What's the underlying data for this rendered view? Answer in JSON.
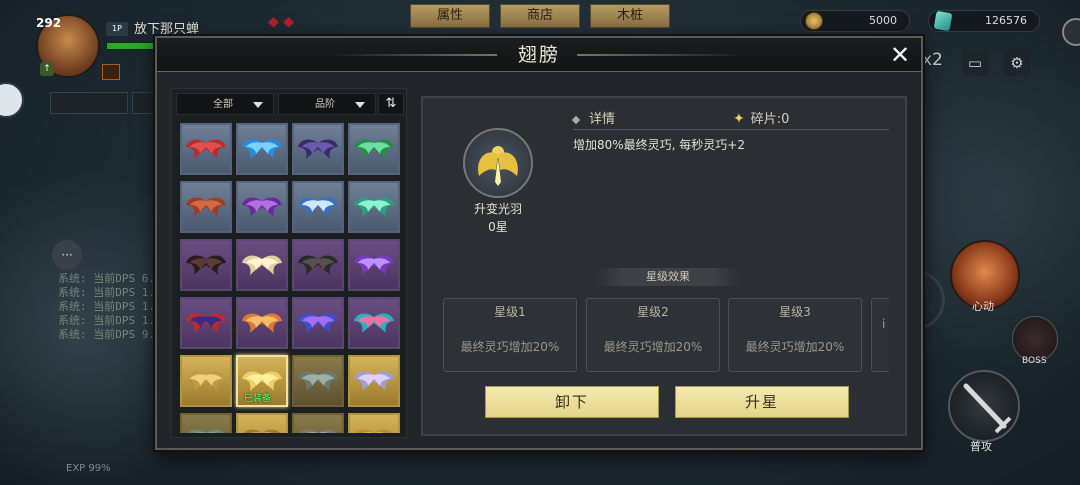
{
  "hud": {
    "player_level": "292",
    "player_name": "放下那只蝉",
    "player_tag": "1P",
    "top_tabs": [
      "属性",
      "商店",
      "木桩"
    ],
    "gold": "5000",
    "gems": "126576",
    "speed": "x2",
    "log_lines": [
      "系统: 当前DPS 6...",
      "系统: 当前DPS 1...",
      "系统: 当前DPS 1...",
      "系统: 当前DPS 1...",
      "系统: 当前DPS 9..."
    ],
    "exp": "EXP 99%",
    "skill_label": "心动",
    "boss_label": "BOSS",
    "attack_label": "普攻"
  },
  "modal": {
    "title": "翅膀",
    "close_icon": "close-icon",
    "filters": {
      "category": "全部",
      "quality": "品阶"
    },
    "grid": [
      {
        "rarity": "blue",
        "colors": [
          "#b03030",
          "#e05050"
        ]
      },
      {
        "rarity": "blue",
        "colors": [
          "#2a8ae0",
          "#7ad0ff"
        ]
      },
      {
        "rarity": "blue",
        "colors": [
          "#3a2a6a",
          "#6a5ab0"
        ]
      },
      {
        "rarity": "blue",
        "colors": [
          "#2a8a4a",
          "#6ae0a0"
        ]
      },
      {
        "rarity": "blue",
        "colors": [
          "#a03a2a",
          "#d06a40"
        ]
      },
      {
        "rarity": "blue",
        "colors": [
          "#6a2a9a",
          "#b070e0"
        ]
      },
      {
        "rarity": "blue",
        "colors": [
          "#3a70c0",
          "#d0e8ff"
        ]
      },
      {
        "rarity": "blue",
        "colors": [
          "#2aa080",
          "#90f0d0"
        ]
      },
      {
        "rarity": "purple",
        "colors": [
          "#2a1a1a",
          "#5a3a3a"
        ]
      },
      {
        "rarity": "purple",
        "colors": [
          "#e0d0a0",
          "#fff4d0"
        ]
      },
      {
        "rarity": "purple",
        "colors": [
          "#2a2a2a",
          "#5a5050"
        ]
      },
      {
        "rarity": "purple",
        "colors": [
          "#7a3ac0",
          "#c090ff"
        ]
      },
      {
        "rarity": "purple",
        "colors": [
          "#c02a2a",
          "#3a2a8a"
        ]
      },
      {
        "rarity": "purple",
        "colors": [
          "#e07a2a",
          "#f0c070"
        ]
      },
      {
        "rarity": "purple",
        "colors": [
          "#3a50d0",
          "#a070f0"
        ]
      },
      {
        "rarity": "purple",
        "colors": [
          "#2ab0c0",
          "#f070a0"
        ]
      },
      {
        "rarity": "gold",
        "colors": [
          "#c09a40",
          "#f0d080"
        ]
      },
      {
        "rarity": "gold",
        "colors": [
          "#f0d060",
          "#fff0a0"
        ],
        "selected": true,
        "equipped": "已装备"
      },
      {
        "rarity": "gold-dim",
        "colors": [
          "#6a7a70",
          "#a0b0a0"
        ]
      },
      {
        "rarity": "gold",
        "colors": [
          "#a0a0d0",
          "#e0d0ff"
        ]
      },
      {
        "rarity": "gold-dim",
        "colors": [
          "#6a8a7a",
          "#90b0a0"
        ]
      },
      {
        "rarity": "gold",
        "colors": [
          "#a07a30",
          "#d0b060"
        ]
      },
      {
        "rarity": "gold-dim",
        "colors": [
          "#7a7a7a",
          "#b0b0b0"
        ]
      },
      {
        "rarity": "gold",
        "colors": [
          "#c08a30",
          "#f0c060"
        ]
      }
    ],
    "detail": {
      "item_name": "升变光羽",
      "item_stars": "0星",
      "details_label": "详情",
      "shards_label": "碎片:0",
      "description": "增加80%最终灵巧, 每秒灵巧+2",
      "star_effects_label": "星级效果",
      "star_cards": [
        {
          "title": "星级1",
          "effect": "最终灵巧增加20%"
        },
        {
          "title": "星级2",
          "effect": "最终灵巧增加20%"
        },
        {
          "title": "星级3",
          "effect": "最终灵巧增加20%"
        },
        {
          "title": "",
          "effect": "i"
        }
      ],
      "unequip_label": "卸下",
      "upgrade_label": "升星"
    }
  }
}
